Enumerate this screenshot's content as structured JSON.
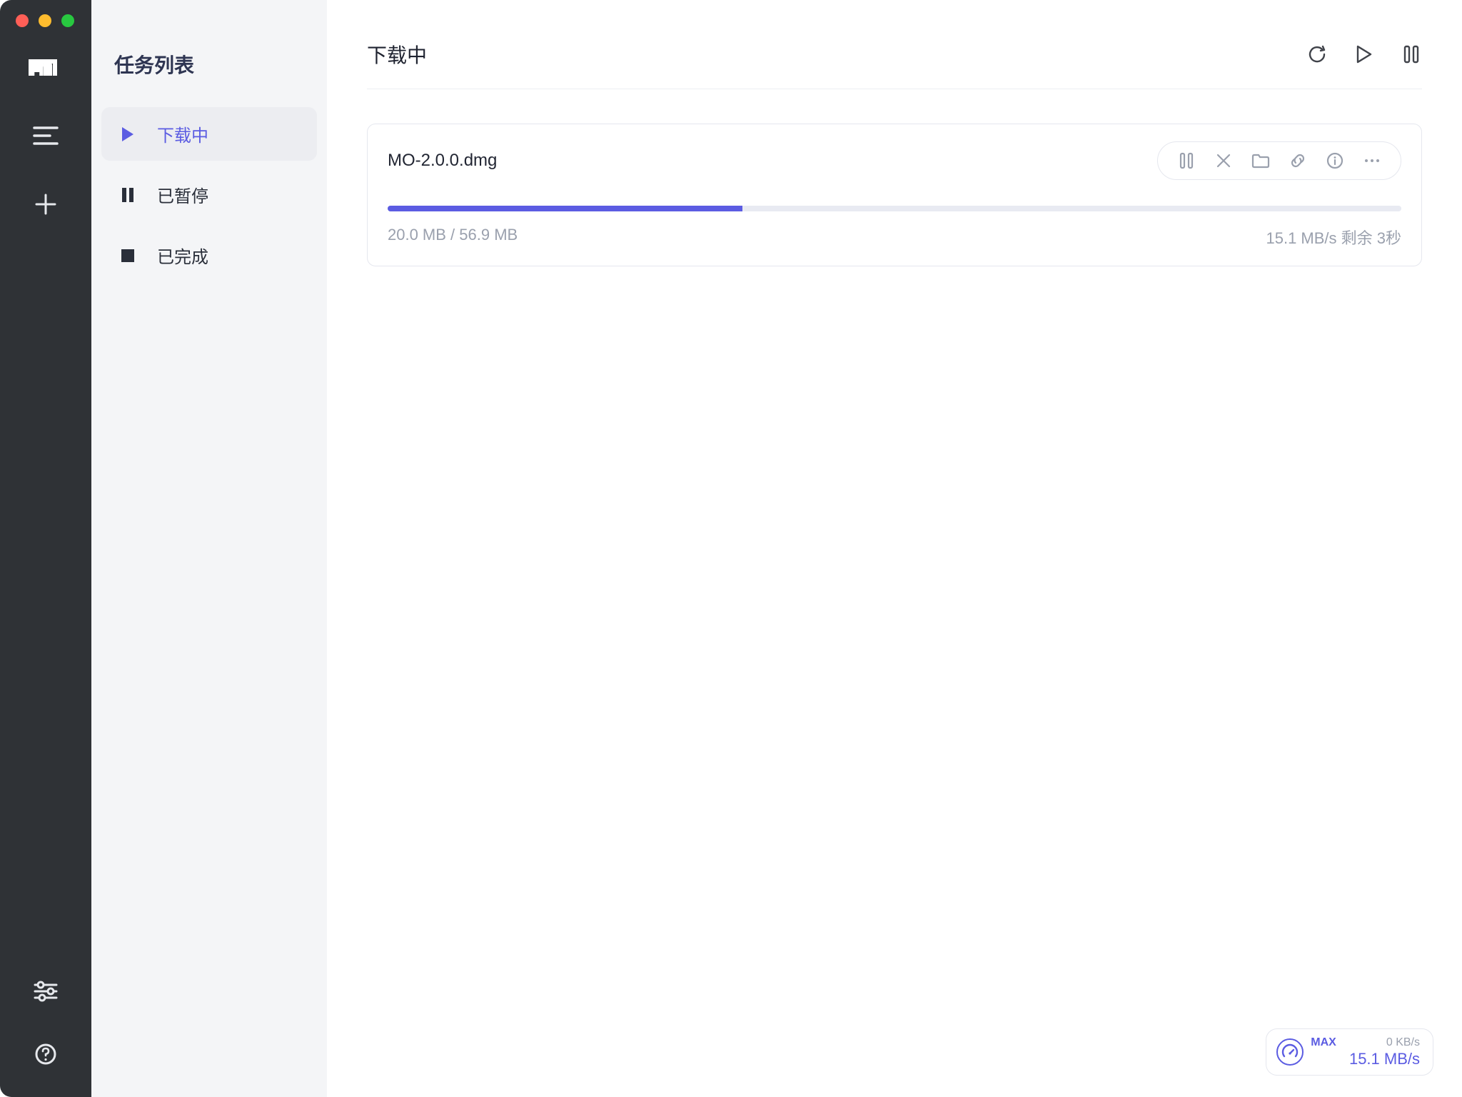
{
  "colors": {
    "accent": "#5b5ce2"
  },
  "sidebar": {
    "title": "任务列表",
    "items": [
      {
        "label": "下载中",
        "icon": "play-icon",
        "active": true
      },
      {
        "label": "已暂停",
        "icon": "pause-icon",
        "active": false
      },
      {
        "label": "已完成",
        "icon": "stop-icon",
        "active": false
      }
    ]
  },
  "header": {
    "title": "下载中",
    "actions": {
      "refresh": "refresh-icon",
      "resume_all": "play-icon",
      "pause_all": "pause-icon"
    }
  },
  "tasks": [
    {
      "name": "MO-2.0.0.dmg",
      "downloaded": "20.0 MB",
      "total": "56.9 MB",
      "size_text": "20.0 MB / 56.9 MB",
      "progress_percent": 35,
      "speed": "15.1 MB/s",
      "eta": "剩余 3秒",
      "speed_eta_text": "15.1 MB/s 剩余 3秒"
    }
  ],
  "speed_badge": {
    "label_max": "MAX",
    "upload_speed": "0 KB/s",
    "download_speed": "15.1 MB/s"
  }
}
